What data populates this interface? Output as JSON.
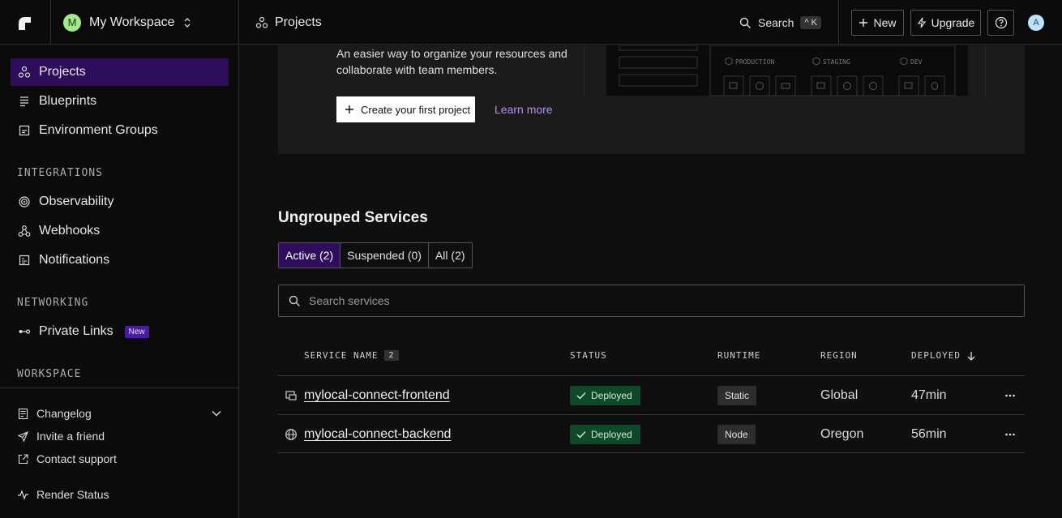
{
  "workspace": {
    "avatar_letter": "M",
    "name": "My Workspace"
  },
  "breadcrumb": {
    "label": "Projects"
  },
  "header": {
    "search_label": "Search",
    "search_shortcut": "^ K",
    "new_label": "New",
    "upgrade_label": "Upgrade",
    "user_initial": "A"
  },
  "sidebar": {
    "items": [
      {
        "label": "Projects"
      },
      {
        "label": "Blueprints"
      },
      {
        "label": "Environment Groups"
      }
    ],
    "integrations_label": "INTEGRATIONS",
    "integrations": [
      {
        "label": "Observability"
      },
      {
        "label": "Webhooks"
      },
      {
        "label": "Notifications"
      }
    ],
    "networking_label": "NETWORKING",
    "networking": [
      {
        "label": "Private Links",
        "badge": "New"
      }
    ],
    "workspace_label": "WORKSPACE",
    "footer": [
      {
        "label": "Changelog"
      },
      {
        "label": "Invite a friend"
      },
      {
        "label": "Contact support"
      },
      {
        "label": "Render Status"
      }
    ]
  },
  "banner": {
    "text": "An easier way to organize your resources and collaborate with team members.",
    "create_label": "Create your first project",
    "learn_more": "Learn more",
    "illustration_tags": [
      "PRODUCTION",
      "STAGING",
      "DEV"
    ]
  },
  "services": {
    "title": "Ungrouped Services",
    "tabs": [
      {
        "label": "Active (2)",
        "active": true
      },
      {
        "label": "Suspended (0)",
        "active": false
      },
      {
        "label": "All (2)",
        "active": false
      }
    ],
    "search_placeholder": "Search services",
    "columns": {
      "name": "SERVICE NAME",
      "count": "2",
      "status": "STATUS",
      "runtime": "RUNTIME",
      "region": "REGION",
      "deployed": "DEPLOYED"
    },
    "rows": [
      {
        "name": "mylocal-connect-frontend",
        "icon": "static-site-icon",
        "status": "Deployed",
        "runtime": "Static",
        "region": "Global",
        "deployed": "47min"
      },
      {
        "name": "mylocal-connect-backend",
        "icon": "globe-icon",
        "status": "Deployed",
        "runtime": "Node",
        "region": "Oregon",
        "deployed": "56min"
      }
    ]
  }
}
